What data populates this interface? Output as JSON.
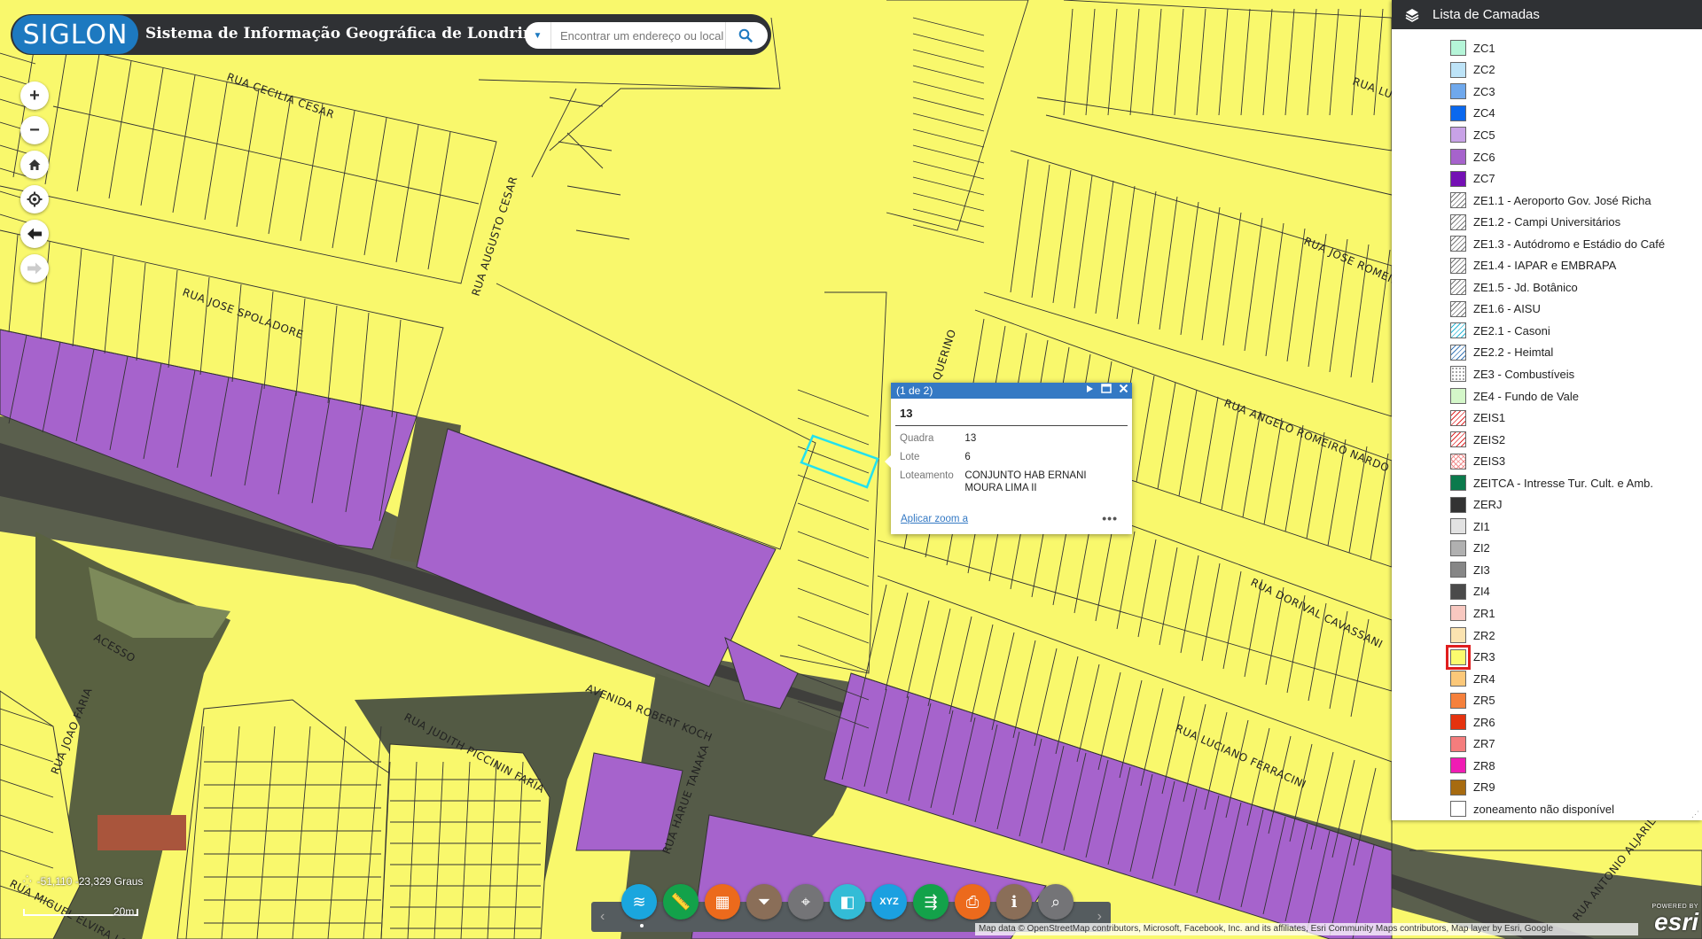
{
  "header": {
    "logo_text": "SIGLON",
    "title": "Sistema de Informação Geográfica de Londrina",
    "search_placeholder": "Encontrar um endereço ou local"
  },
  "nav_tools": [
    "zoom-in",
    "zoom-out",
    "home",
    "locate",
    "previous-extent",
    "next-extent"
  ],
  "map": {
    "zone_colors": {
      "ZR3": "#fbfb6e",
      "ZC6": "#a663cc",
      "selection": "#22e1ef"
    },
    "street_labels": [
      "RUA CECILIA CESAR",
      "RUA JOSE SPOLADORE",
      "RUA AUGUSTO CESAR",
      "QUERINO",
      "RUA ANGELO ROMEIRO NARDO",
      "RUA JOSE ROMEIRO",
      "RUA LUZ",
      "RUA DORIVAL CAVASSANI",
      "RUA LUCIANO FERRACINI",
      "AVENIDA ROBERT KOCH",
      "RUA JUDITH PICCININ FARIA",
      "RUA JOAO FARIA",
      "ACESSO",
      "RUA HARUE TANAKA",
      "RUA MIGUEL ELVIRA LOPES",
      "RUA ANTONIO ALJARILLA B"
    ]
  },
  "popup": {
    "counter": "(1 de 2)",
    "title": "13",
    "fields": [
      {
        "label": "Quadra",
        "value": "13"
      },
      {
        "label": "Lote",
        "value": "6"
      },
      {
        "label": "Loteamento",
        "value": "CONJUNTO HAB ERNANI MOURA LIMA II"
      }
    ],
    "zoom_link": "Aplicar zoom a",
    "more": "•••"
  },
  "layer_panel": {
    "title": "Lista de Camadas",
    "items": [
      {
        "label": "ZC1",
        "color": "#b5f5d8",
        "pattern": "solid"
      },
      {
        "label": "ZC2",
        "color": "#bde3f7",
        "pattern": "solid"
      },
      {
        "label": "ZC3",
        "color": "#6fa8ec",
        "pattern": "solid"
      },
      {
        "label": "ZC4",
        "color": "#0a68ee",
        "pattern": "solid"
      },
      {
        "label": "ZC5",
        "color": "#c8a2e6",
        "pattern": "solid"
      },
      {
        "label": "ZC6",
        "color": "#a663cc",
        "pattern": "solid"
      },
      {
        "label": "ZC7",
        "color": "#7410b4",
        "pattern": "solid"
      },
      {
        "label": "ZE1.1 - Aeroporto Gov. José Richa",
        "color": "#777777",
        "pattern": "hatch-grey"
      },
      {
        "label": "ZE1.2 - Campi Universitários",
        "color": "#777777",
        "pattern": "hatch-grey"
      },
      {
        "label": "ZE1.3 - Autódromo e Estádio do Café",
        "color": "#777777",
        "pattern": "hatch-grey"
      },
      {
        "label": "ZE1.4 - IAPAR e EMBRAPA",
        "color": "#777777",
        "pattern": "hatch-grey"
      },
      {
        "label": "ZE1.5 - Jd. Botânico",
        "color": "#777777",
        "pattern": "hatch-grey"
      },
      {
        "label": "ZE1.6 - AISU",
        "color": "#777777",
        "pattern": "hatch-grey"
      },
      {
        "label": "ZE2.1 - Casoni",
        "color": "#2bb8d6",
        "pattern": "hatch-cyan"
      },
      {
        "label": "ZE2.2 - Heimtal",
        "color": "#3a78b8",
        "pattern": "hatch-blue"
      },
      {
        "label": "ZE3 - Combustíveis",
        "color": "#888888",
        "pattern": "dots"
      },
      {
        "label": "ZE4 - Fundo de Vale",
        "color": "#d4f7c9",
        "pattern": "solid"
      },
      {
        "label": "ZEIS1",
        "color": "#e02a2a",
        "pattern": "hatch-red"
      },
      {
        "label": "ZEIS2",
        "color": "#e02a2a",
        "pattern": "hatch-red"
      },
      {
        "label": "ZEIS3",
        "color": "#f08a8a",
        "pattern": "hatch-cross"
      },
      {
        "label": "ZEITCA - Intresse Tur. Cult. e Amb.",
        "color": "#0b7a4c",
        "pattern": "solid"
      },
      {
        "label": "ZERJ",
        "color": "#333333",
        "pattern": "solid"
      },
      {
        "label": "ZI1",
        "color": "#e2e2e2",
        "pattern": "solid"
      },
      {
        "label": "ZI2",
        "color": "#b0b0b0",
        "pattern": "solid"
      },
      {
        "label": "ZI3",
        "color": "#868686",
        "pattern": "solid"
      },
      {
        "label": "ZI4",
        "color": "#4a4a4a",
        "pattern": "solid"
      },
      {
        "label": "ZR1",
        "color": "#f8c8c0",
        "pattern": "solid"
      },
      {
        "label": "ZR2",
        "color": "#fbe3b0",
        "pattern": "solid"
      },
      {
        "label": "ZR3",
        "color": "#fbfb6e",
        "pattern": "solid",
        "highlight": true
      },
      {
        "label": "ZR4",
        "color": "#fcc879",
        "pattern": "solid"
      },
      {
        "label": "ZR5",
        "color": "#f5803c",
        "pattern": "solid"
      },
      {
        "label": "ZR6",
        "color": "#e5330f",
        "pattern": "solid"
      },
      {
        "label": "ZR7",
        "color": "#f47d7d",
        "pattern": "solid"
      },
      {
        "label": "ZR8",
        "color": "#f01cb4",
        "pattern": "solid"
      },
      {
        "label": "ZR9",
        "color": "#a76b10",
        "pattern": "solid"
      },
      {
        "label": "zoneamento não disponível",
        "color": "#ffffff",
        "pattern": "solid"
      }
    ]
  },
  "toolbar": {
    "tools": [
      {
        "name": "layers-tool",
        "icon": "layers-icon",
        "color": "#1aa6de"
      },
      {
        "name": "measure-tool",
        "icon": "ruler-icon",
        "color": "#13a24a"
      },
      {
        "name": "basemap-tool",
        "icon": "grid-icon",
        "color": "#ec6a1c"
      },
      {
        "name": "filter-tool",
        "icon": "filter-icon",
        "color": "#8a6e58"
      },
      {
        "name": "location-tool",
        "icon": "pin-icon",
        "color": "#747477"
      },
      {
        "name": "swipe-tool",
        "icon": "swipe-icon",
        "color": "#33bcd6"
      },
      {
        "name": "coordinates-tool",
        "icon": "xyz-icon",
        "color": "#1ba0e0"
      },
      {
        "name": "share-tool",
        "icon": "share-icon",
        "color": "#13a24a"
      },
      {
        "name": "print-tool",
        "icon": "printer-icon",
        "color": "#ec6a1c"
      },
      {
        "name": "about-tool",
        "icon": "info-icon",
        "color": "#8a6e58"
      },
      {
        "name": "query-tool",
        "icon": "search-map-icon",
        "color": "#747477"
      }
    ]
  },
  "status": {
    "coordinates": "-51,110 -23,329 Graus",
    "scale": "20m",
    "attribution": "Map data © OpenStreetMap contributors, Microsoft, Facebook, Inc. and its affiliates, Esri Community Maps contributors, Map layer by Esri, Google",
    "esri_powered": "POWERED BY",
    "esri_word": "esri"
  }
}
